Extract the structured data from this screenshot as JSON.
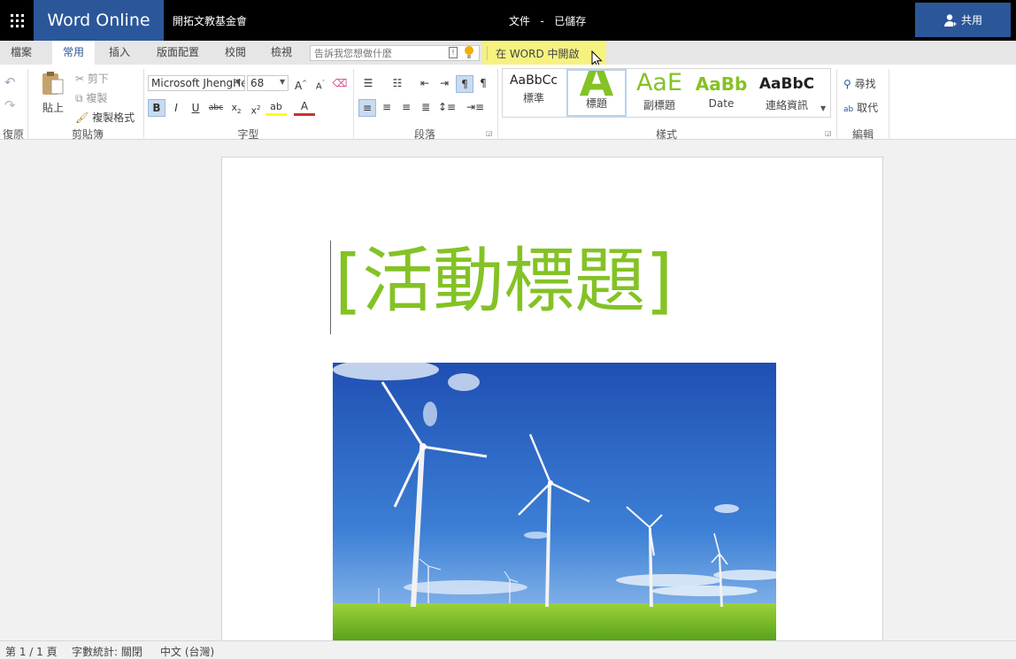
{
  "topbar": {
    "app_name": "Word Online",
    "org_name": "開拓文教基金會",
    "doc_title": "文件   -   已儲存",
    "share_label": "共用"
  },
  "tabs": [
    "檔案",
    "常用",
    "插入",
    "版面配置",
    "校閱",
    "檢視"
  ],
  "tell_me": {
    "placeholder": "告訴我您想做什麼"
  },
  "open_in_word": "在 WORD 中開啟",
  "ribbon": {
    "undo_group": "復原",
    "clipboard": {
      "paste": "貼上",
      "cut": "剪下",
      "copy": "複製",
      "format_painter": "複製格式",
      "group": "剪貼簿"
    },
    "font": {
      "font_name": "Microsoft JhengHei",
      "font_size": "68",
      "group": "字型"
    },
    "paragraph": {
      "group": "段落"
    },
    "styles": {
      "items": [
        {
          "sample": "AaBbCc",
          "label": "標準"
        },
        {
          "sample": "A",
          "label": "標題"
        },
        {
          "sample": "AaE",
          "label": "副標題"
        },
        {
          "sample": "AaBb",
          "label": "Date"
        },
        {
          "sample": "AaBbC",
          "label": "連絡資訊"
        }
      ],
      "group": "樣式"
    },
    "editing": {
      "find": "尋找",
      "replace": "取代",
      "group": "編輯"
    }
  },
  "document": {
    "heading": "[活動標題]"
  },
  "status": {
    "page": "第 1 / 1 頁",
    "word_count": "字數統計: 關閉",
    "language": "中文 (台灣)"
  },
  "colors": {
    "brand_blue": "#2b579a",
    "title_green": "#84c225",
    "highlight_yellow": "#f6f27a"
  }
}
